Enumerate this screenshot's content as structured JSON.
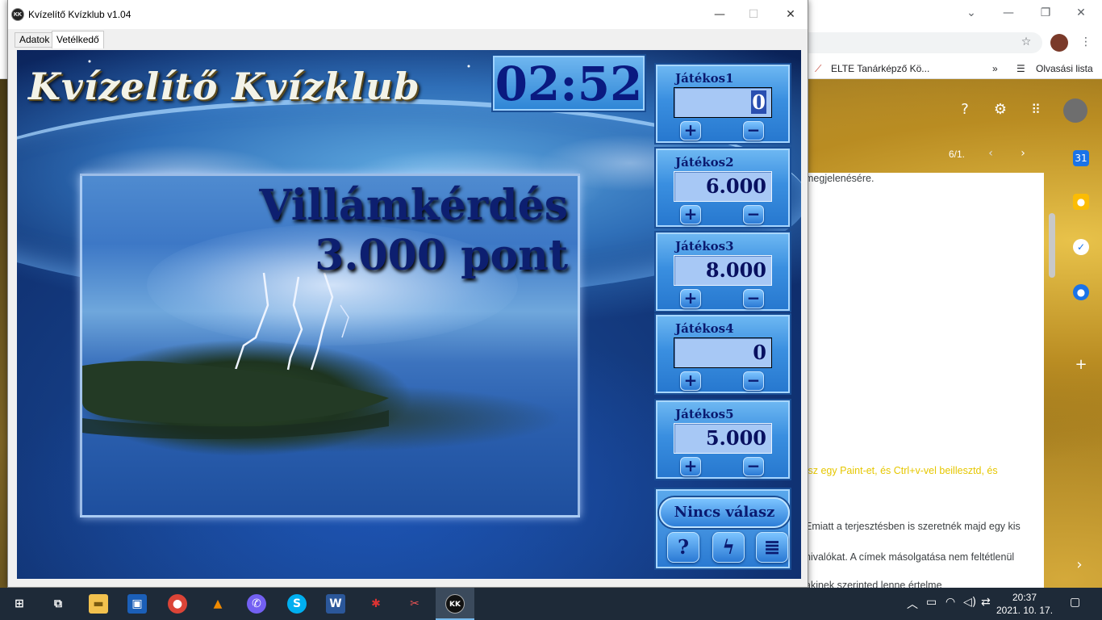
{
  "browser": {
    "bookmark_label": "ELTE Tanárképző Kö...",
    "more_bookmarks": "»",
    "reading_list": "Olvasási lista",
    "page_counter": "6/1.",
    "doc_lines": [
      "megjelenésére.",
      "tsz egy Paint-et, és Ctrl+v-vel beillesztd, és",
      "Emiatt a terjesztésben is szeretnék majd egy kis",
      "nivalókat. A címek másolgatása nem feltétlenül",
      "akinek szerinted lenne értelme"
    ]
  },
  "app": {
    "title": "Kvízelítő Kvízklub v1.04",
    "tabs": [
      "Adatok",
      "Vetélkedő"
    ],
    "logo": "Kvízelítő Kvízklub",
    "timer": "02:52",
    "question_title": "Villámkérdés",
    "question_points": "3.000 pont",
    "players": [
      {
        "name": "Játékos1",
        "score": "0"
      },
      {
        "name": "Játékos2",
        "score": "6.000"
      },
      {
        "name": "Játékos3",
        "score": "8.000"
      },
      {
        "name": "Játékos4",
        "score": "0"
      },
      {
        "name": "Játékos5",
        "score": "5.000"
      }
    ],
    "plus_label": "+",
    "minus_label": "−",
    "no_answer": "Nincs válasz",
    "tool_buttons": [
      "?",
      "ϟ",
      "≣"
    ]
  },
  "taskbar": {
    "time": "20:37",
    "date": "2021. 10. 17."
  },
  "icons": [
    "windows-start-icon",
    "task-view-icon",
    "file-explorer-icon",
    "save-disk-icon",
    "chrome-icon",
    "vlc-icon",
    "viber-icon",
    "skype-icon",
    "word-icon",
    "paint-icon",
    "snipping-icon",
    "quiz-app-icon"
  ],
  "colors": {
    "accent": "#2a79d4",
    "score_text": "#081060",
    "title_text": "#0d1f70"
  }
}
